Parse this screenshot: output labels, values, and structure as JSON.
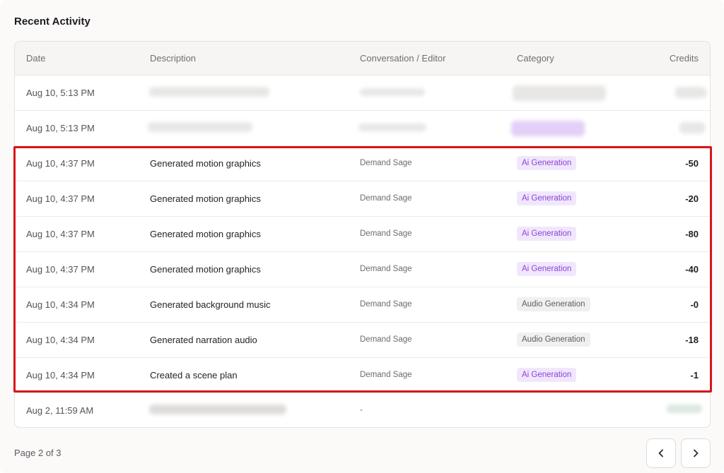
{
  "section": {
    "title": "Recent Activity"
  },
  "table": {
    "headers": {
      "date": "Date",
      "description": "Description",
      "conversation": "Conversation / Editor",
      "category": "Category",
      "credits": "Credits"
    },
    "rows": [
      {
        "date": "Aug 10, 5:13 PM",
        "description": "",
        "conversation": "",
        "category": "",
        "category_type": "blurred",
        "credits": ""
      },
      {
        "date": "Aug 10, 5:13 PM",
        "description": "",
        "conversation": "",
        "category": "",
        "category_type": "blurred",
        "credits": ""
      },
      {
        "date": "Aug 10, 4:37 PM",
        "description": "Generated motion graphics",
        "conversation": "Demand Sage",
        "category": "Ai Generation",
        "category_type": "ai",
        "credits": "-50"
      },
      {
        "date": "Aug 10, 4:37 PM",
        "description": "Generated motion graphics",
        "conversation": "Demand Sage",
        "category": "Ai Generation",
        "category_type": "ai",
        "credits": "-20"
      },
      {
        "date": "Aug 10, 4:37 PM",
        "description": "Generated motion graphics",
        "conversation": "Demand Sage",
        "category": "Ai Generation",
        "category_type": "ai",
        "credits": "-80"
      },
      {
        "date": "Aug 10, 4:37 PM",
        "description": "Generated motion graphics",
        "conversation": "Demand Sage",
        "category": "Ai Generation",
        "category_type": "ai",
        "credits": "-40"
      },
      {
        "date": "Aug 10, 4:34 PM",
        "description": "Generated background music",
        "conversation": "Demand Sage",
        "category": "Audio Generation",
        "category_type": "audio",
        "credits": "-0"
      },
      {
        "date": "Aug 10, 4:34 PM",
        "description": "Generated narration audio",
        "conversation": "Demand Sage",
        "category": "Audio Generation",
        "category_type": "audio",
        "credits": "-18"
      },
      {
        "date": "Aug 10, 4:34 PM",
        "description": "Created a scene plan",
        "conversation": "Demand Sage",
        "category": "Ai Generation",
        "category_type": "ai",
        "credits": "-1"
      },
      {
        "date": "Aug 2, 11:59 AM",
        "description": "",
        "conversation": "-",
        "category": "",
        "category_type": "none",
        "credits": ""
      }
    ]
  },
  "pagination": {
    "label": "Page 2 of 3",
    "prev_icon": "chevron-left-icon",
    "next_icon": "chevron-right-icon"
  },
  "colors": {
    "highlight_border": "#d7161c",
    "ai_badge_bg": "#f1e7fd",
    "ai_badge_text": "#8a43d6",
    "audio_badge_bg": "#f1f0ee",
    "audio_badge_text": "#5d5c61"
  }
}
